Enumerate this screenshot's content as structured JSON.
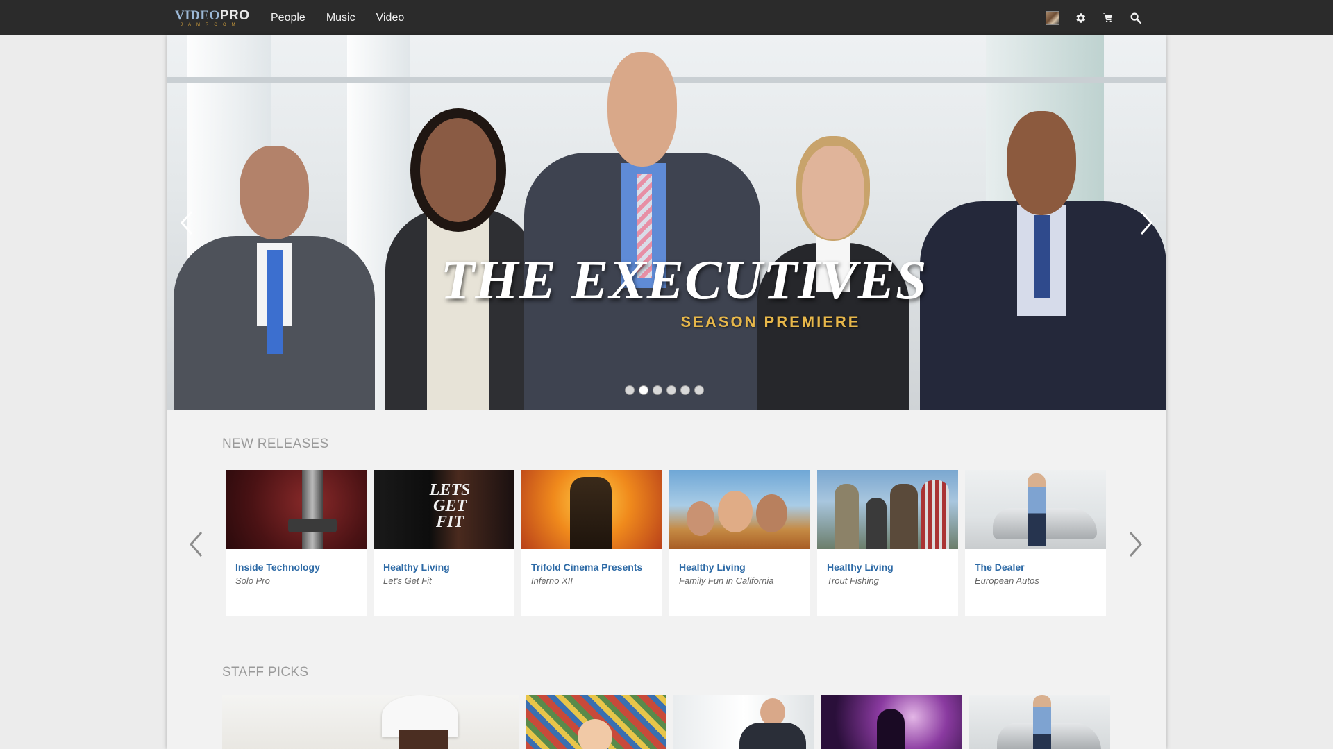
{
  "brand": {
    "logo_main": "VIDEO",
    "logo_accent": "PRO",
    "logo_sub": "JAMROOM"
  },
  "nav": {
    "links": [
      "People",
      "Music",
      "Video"
    ]
  },
  "nav_icons": [
    "avatar",
    "gear-icon",
    "cart-icon",
    "search-icon"
  ],
  "hero": {
    "title": "THE EXECUTIVES",
    "subtitle": "SEASON PREMIERE",
    "slides": 6,
    "active_slide": 2
  },
  "new_releases": {
    "heading": "NEW RELEASES",
    "items": [
      {
        "title": "Inside Technology",
        "subtitle": "Solo Pro"
      },
      {
        "title": "Healthy Living",
        "subtitle": "Let's Get Fit"
      },
      {
        "title": "Trifold Cinema Presents",
        "subtitle": "Inferno XII"
      },
      {
        "title": "Healthy Living",
        "subtitle": "Family Fun in California"
      },
      {
        "title": "Healthy Living",
        "subtitle": "Trout Fishing"
      },
      {
        "title": "The Dealer",
        "subtitle": "European Autos"
      }
    ]
  },
  "staff_picks": {
    "heading": "STAFF PICKS"
  },
  "colors": {
    "nav_bg": "#2b2b2b",
    "link": "#2d6aa6",
    "accent_gold": "#e7b74a"
  }
}
